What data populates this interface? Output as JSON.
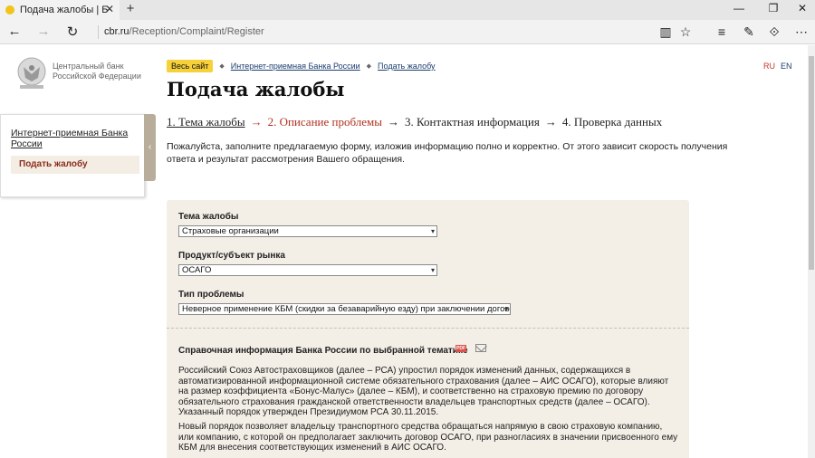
{
  "browser": {
    "tab_title": "Подача жалобы | Банк",
    "tab_close": "✕",
    "new_tab": "+",
    "url_host": "cbr.ru",
    "url_path": "/Reception/Complaint/Register"
  },
  "logo": {
    "line1": "Центральный банк",
    "line2": "Российской Федерации"
  },
  "breadcrumb": {
    "site_label": "Весь сайт",
    "items": [
      "Интернет-приемная Банка России",
      "Подать жалобу"
    ]
  },
  "languages": [
    "RU",
    "EN"
  ],
  "page_title": "Подача жалобы",
  "steps": [
    "1. Тема жалобы",
    "2. Описание проблемы",
    "3. Контактная информация",
    "4. Проверка данных"
  ],
  "intro": "Пожалуйста, заполните предлагаемую форму, изложив информацию полно и корректно. От этого зависит скорость получения ответа и результат рассмотрения Вашего обращения.",
  "sidebar": {
    "link": "Интернет-приемная Банка России",
    "active": "Подать жалобу"
  },
  "form": {
    "topic_label": "Тема жалобы",
    "topic_value": "Страховые организации",
    "product_label": "Продукт/субъект рынка",
    "product_value": "ОСАГО",
    "problem_label": "Тип проблемы",
    "problem_value": "Неверное применение КБМ (скидки за безаварийную езду) при заключении договора"
  },
  "info": {
    "title": "Справочная информация Банка России по выбранной тематике",
    "pdf_label": "PDF",
    "paragraph1": "Российский Союз Автостраховщиков (далее – РСА) упростил порядок изменений данных, содержащихся в автоматизированной информационной системе обязательного страхования (далее – АИС ОСАГО), которые влияют на размер коэффициента «Бонус-Малус» (далее – КБМ), и соответственно на страховую премию по договору обязательного страхования гражданской ответственности владельцев транспортных средств (далее – ОСАГО). Указанный порядок утвержден Президиумом РСА 30.11.2015.",
    "paragraph2": "Новый порядок позволяет владельцу транспортного средства обращаться напрямую в свою страховую компанию, или компанию, с которой он предполагает заключить договор ОСАГО, при разногласиях в значении присвоенного ему КБМ для внесения соответствующих изменений в АИС ОСАГО."
  },
  "colors": {
    "accent_red": "#b0321d",
    "panel_bg": "#f3efe7",
    "badge_yellow": "#f6d13a"
  }
}
